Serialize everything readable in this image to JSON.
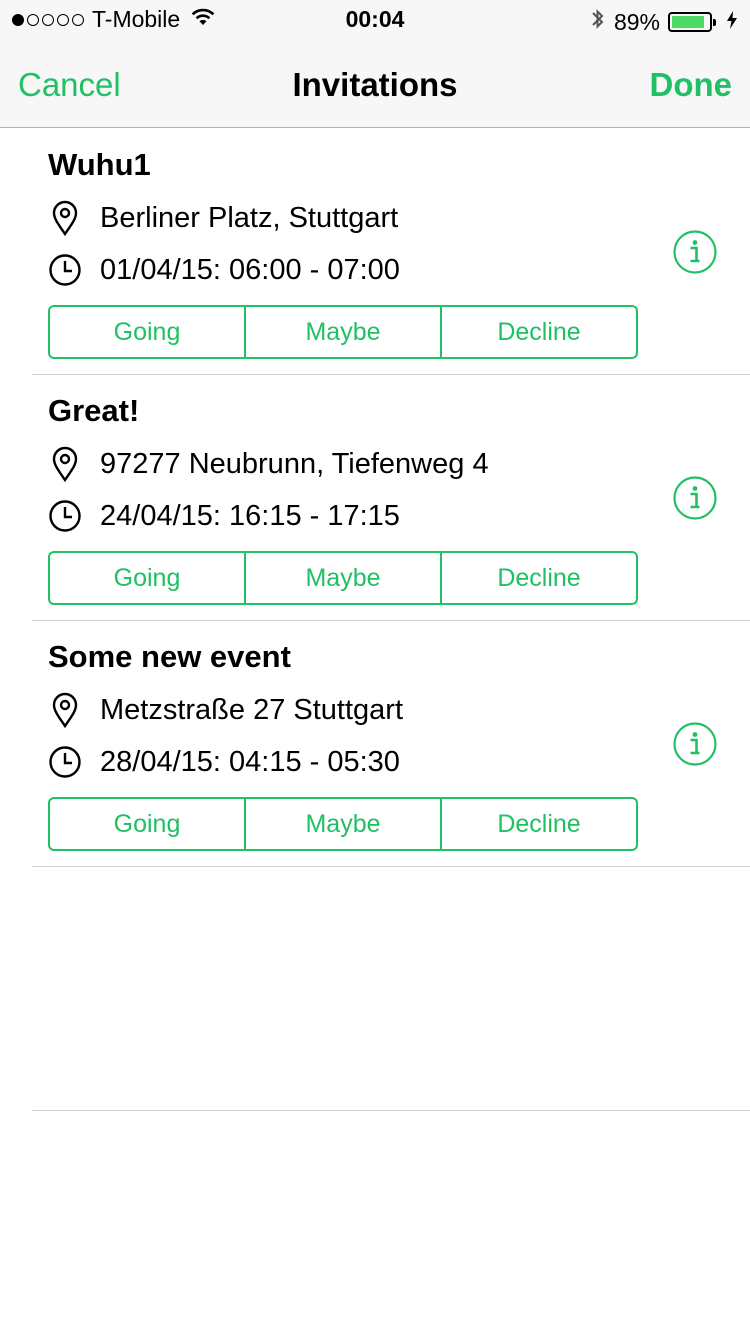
{
  "status_bar": {
    "carrier": "T-Mobile",
    "signal_dots_total": 5,
    "signal_dots_filled": 1,
    "time": "00:04",
    "battery_percent": "89%",
    "battery_level": 0.89
  },
  "nav": {
    "cancel_label": "Cancel",
    "title": "Invitations",
    "done_label": "Done"
  },
  "colors": {
    "accent": "#21c064",
    "battery": "#4cd964"
  },
  "events": [
    {
      "title": "Wuhu1",
      "location": "Berliner Platz, Stuttgart",
      "time": "01/04/15: 06:00 - 07:00",
      "options": [
        "Going",
        "Maybe",
        "Decline"
      ]
    },
    {
      "title": "Great!",
      "location": "97277 Neubrunn, Tiefenweg 4",
      "time": "24/04/15: 16:15 - 17:15",
      "options": [
        "Going",
        "Maybe",
        "Decline"
      ]
    },
    {
      "title": "Some new event",
      "location": "Metzstraße 27 Stuttgart",
      "time": "28/04/15: 04:15 - 05:30",
      "options": [
        "Going",
        "Maybe",
        "Decline"
      ]
    }
  ],
  "icons": {
    "location": "map-pin-icon",
    "time": "clock-icon",
    "info": "info-icon"
  }
}
